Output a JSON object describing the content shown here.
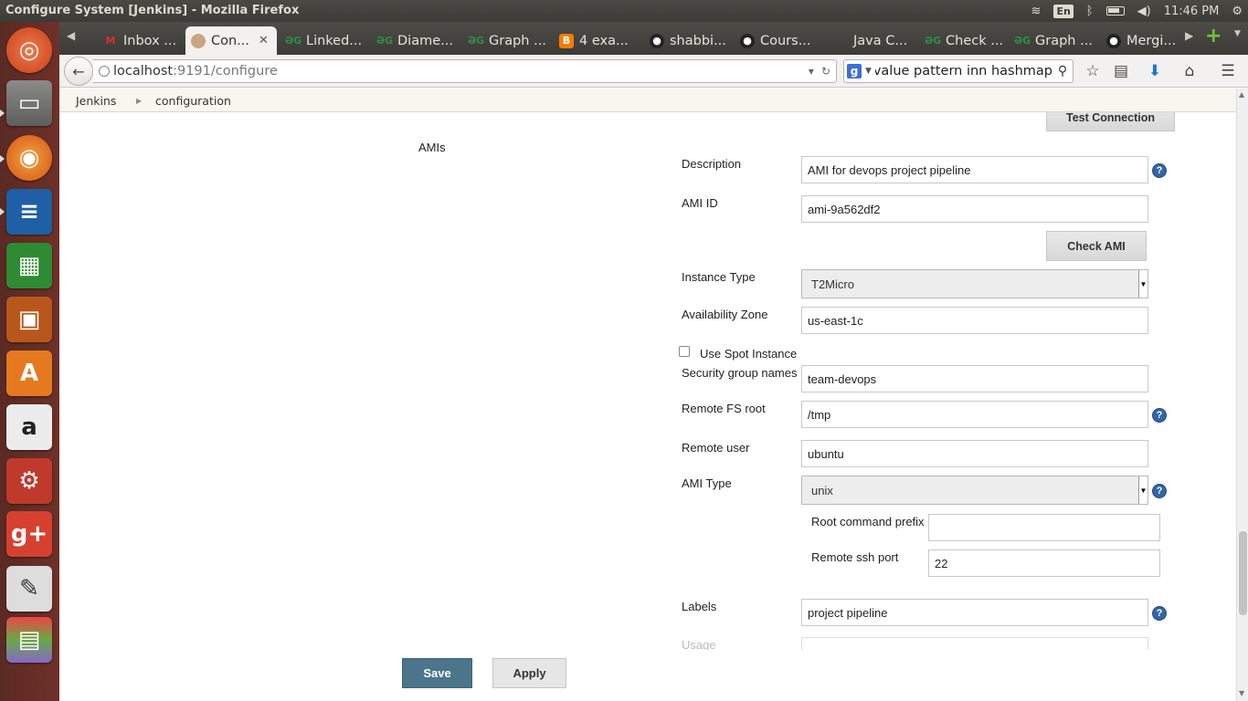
{
  "window": {
    "title": "Configure System [Jenkins] - Mozilla Firefox"
  },
  "panel": {
    "keyboard": "En",
    "clock": "11:46 PM"
  },
  "tabs": [
    {
      "label": "Inbox ...",
      "icon": "gmail-icon"
    },
    {
      "label": "Con...",
      "icon": "jenkins-icon",
      "active": true
    },
    {
      "label": "Linked...",
      "icon": "geeksforgeeks-icon"
    },
    {
      "label": "Diame...",
      "icon": "geeksforgeeks-icon"
    },
    {
      "label": "Graph ...",
      "icon": "geeksforgeeks-icon"
    },
    {
      "label": "4 exa...",
      "icon": "blogger-icon"
    },
    {
      "label": "shabbi...",
      "icon": "github-icon"
    },
    {
      "label": "Cours...",
      "icon": "github-icon"
    },
    {
      "label": "Java C...",
      "icon": "text-icon"
    },
    {
      "label": "Check ...",
      "icon": "geeksforgeeks-icon"
    },
    {
      "label": "Graph ...",
      "icon": "geeksforgeeks-icon"
    },
    {
      "label": "Mergi...",
      "icon": "github-icon"
    }
  ],
  "navbar": {
    "url_host": "localhost",
    "url_path": ":9191/configure",
    "search_query": "ro value pattern inn hashmap"
  },
  "breadcrumb": {
    "item1": "Jenkins",
    "item2": "configuration"
  },
  "form": {
    "test_connection": "Test Connection",
    "section_label": "AMIs",
    "description_label": "Description",
    "description_value": "AMI for devops project pipeline",
    "ami_id_label": "AMI ID",
    "ami_id_value": "ami-9a562df2",
    "check_ami": "Check AMI",
    "instance_type_label": "Instance Type",
    "instance_type_value": "T2Micro",
    "availability_zone_label": "Availability Zone",
    "availability_zone_value": "us-east-1c",
    "use_spot_label": "Use Spot Instance",
    "use_spot_checked": false,
    "security_groups_label": "Security group names",
    "security_groups_value": "team-devops",
    "remote_fs_label": "Remote FS root",
    "remote_fs_value": "/tmp",
    "remote_user_label": "Remote user",
    "remote_user_value": "ubuntu",
    "ami_type_label": "AMI Type",
    "ami_type_value": "unix",
    "root_prefix_label": "Root command prefix",
    "root_prefix_value": "",
    "ssh_port_label": "Remote ssh port",
    "ssh_port_value": "22",
    "labels_label": "Labels",
    "labels_value": "project pipeline",
    "usage_label": "Usage",
    "help_glyph": "?"
  },
  "buttons": {
    "save": "Save",
    "apply": "Apply"
  },
  "colors": {
    "save_button": "#4b758b",
    "help_icon": "#3465a4",
    "launcher": "#6e3128"
  }
}
